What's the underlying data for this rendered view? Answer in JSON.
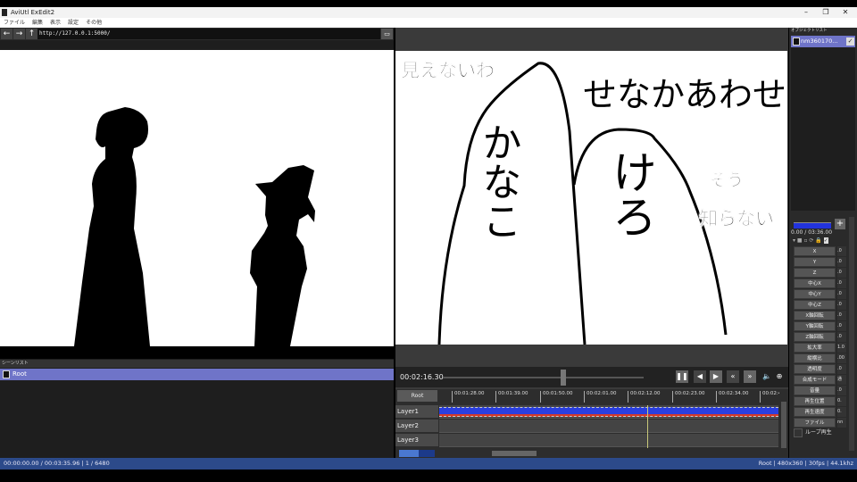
{
  "window": {
    "title": "AviUtl ExEdit2",
    "minimize": "–",
    "maximize": "❐",
    "close": "✕"
  },
  "menu": [
    "ファイル",
    "編集",
    "表示",
    "設定",
    "その他"
  ],
  "browser": {
    "back": "←",
    "forward": "→",
    "up": "↑",
    "url": "http://127.0.0.1:5000/",
    "folder_icon": "folder-icon"
  },
  "scene_list": {
    "header": "シーンリスト",
    "items": [
      "Root"
    ]
  },
  "preview": {
    "texts": {
      "mienai": "見えないわ",
      "senaka": "せなかあわせ",
      "sou": "そう",
      "shiranai": "知らない",
      "kanako": "かなこ",
      "kero": "けろ"
    }
  },
  "player": {
    "time": "00:02:16.30",
    "seek_fraction": 0.6,
    "buttons": [
      "❚❚",
      "◀",
      "▶",
      "«",
      "»"
    ],
    "volume": "🔈",
    "zoom": "⊕"
  },
  "timeline": {
    "root_label": "Root",
    "ticks": [
      "00:01:28.00",
      "00:01:39.00",
      "00:01:50.00",
      "00:02:01.00",
      "00:02:12.00",
      "00:02:23.00",
      "00:02:34.00",
      "00:02:4"
    ],
    "layers": [
      "Layer1",
      "Layer2",
      "Layer3"
    ],
    "clip_colors": {
      "top": "#2a3fe0",
      "bottom": "#d23a2a"
    }
  },
  "object_list": {
    "header": "オブジェクトリスト",
    "items": [
      "nm360170..."
    ]
  },
  "properties": {
    "range": "0.00 / 03:36.00",
    "add": "+",
    "items": [
      {
        "label": "X",
        "value": ".0"
      },
      {
        "label": "Y",
        "value": ".0"
      },
      {
        "label": "Z",
        "value": ".0"
      },
      {
        "label": "中心X",
        "value": ".0"
      },
      {
        "label": "中心Y",
        "value": ".0"
      },
      {
        "label": "中心Z",
        "value": ".0"
      },
      {
        "label": "X軸回転",
        "value": ".0"
      },
      {
        "label": "Y軸回転",
        "value": ".0"
      },
      {
        "label": "Z軸回転",
        "value": ".0"
      },
      {
        "label": "拡大率",
        "value": "1.0"
      },
      {
        "label": "縦横比",
        "value": ".00"
      },
      {
        "label": "透明度",
        "value": ".0"
      },
      {
        "label": "合成モード",
        "value": "通"
      },
      {
        "label": "音量",
        "value": ".0"
      },
      {
        "label": "再生位置",
        "value": "0."
      },
      {
        "label": "再生速度",
        "value": "0."
      },
      {
        "label": "ファイル",
        "value": "nn"
      }
    ],
    "loop": "ループ再生"
  },
  "status": {
    "left": "00:00:00.00 / 00:03:35.96  |  1 / 6480",
    "right": "Root  |  480x360  |  30fps  |  44.1khz"
  },
  "colors": {
    "accent": "#6f74c8",
    "status": "#2c4a8a"
  }
}
